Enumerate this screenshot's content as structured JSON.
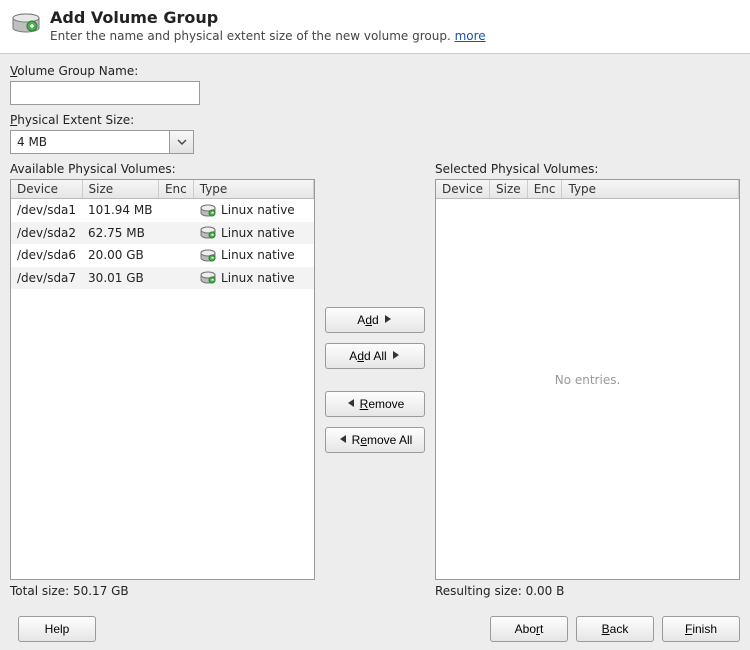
{
  "header": {
    "title": "Add Volume Group",
    "subtitle_prefix": "Enter the name and physical extent size of the new volume group. ",
    "more_link": "more"
  },
  "fields": {
    "vg_name_label_pre": "V",
    "vg_name_label_post": "olume Group Name:",
    "vg_name_value": "",
    "pes_label_pre": "P",
    "pes_label_post": "hysical Extent Size:",
    "pes_value": "4 MB"
  },
  "panes": {
    "available_label": "Available Physical Volumes:",
    "selected_label": "Selected Physical Volumes:",
    "columns": {
      "device": "Device",
      "size": "Size",
      "enc": "Enc",
      "type": "Type"
    },
    "available": [
      {
        "device": "/dev/sda1",
        "size": "101.94 MB",
        "enc": "",
        "type": "Linux native"
      },
      {
        "device": "/dev/sda2",
        "size": "62.75 MB",
        "enc": "",
        "type": "Linux native"
      },
      {
        "device": "/dev/sda6",
        "size": "20.00 GB",
        "enc": "",
        "type": "Linux native"
      },
      {
        "device": "/dev/sda7",
        "size": "30.01 GB",
        "enc": "",
        "type": "Linux native"
      }
    ],
    "selected_empty": "No entries.",
    "total_size_label": "Total size: ",
    "total_size_value": "50.17 GB",
    "resulting_size_label": "Resulting size: ",
    "resulting_size_value": "0.00 B"
  },
  "buttons": {
    "add_pre": "A",
    "add_key": "d",
    "add_post": "d",
    "addall_pre": "A",
    "addall_key": "d",
    "addall_post": "d All",
    "remove_pre": "",
    "remove_key": "R",
    "remove_post": "emove",
    "removeall_pre": "R",
    "removeall_key": "e",
    "removeall_post": "move All",
    "help": "Help",
    "abort_pre": "Abo",
    "abort_key": "r",
    "abort_post": "t",
    "back_pre": "",
    "back_key": "B",
    "back_post": "ack",
    "finish_pre": "",
    "finish_key": "F",
    "finish_post": "inish"
  }
}
